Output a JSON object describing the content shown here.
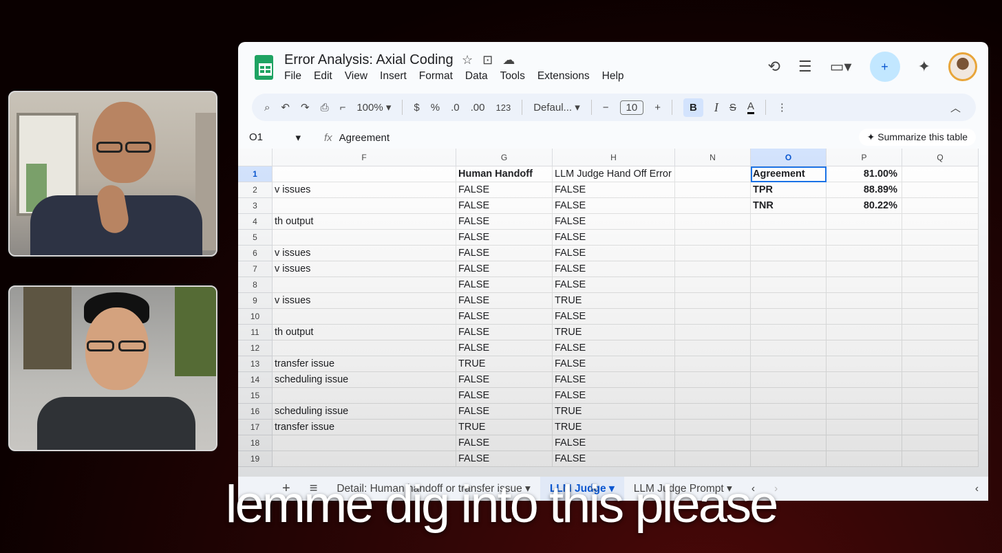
{
  "sheet": {
    "title": "Error Analysis: Axial Coding",
    "menu": [
      "File",
      "Edit",
      "View",
      "Insert",
      "Format",
      "Data",
      "Tools",
      "Extensions",
      "Help"
    ],
    "toolbar": {
      "zoom": "100%",
      "currency": "$",
      "percent": "%",
      "dec_decrease": ".0",
      "dec_increase": ".00",
      "more_formats": "123",
      "font": "Defaul...",
      "font_size": "10",
      "bold": "B",
      "italic": "I",
      "strike": "S",
      "text_color": "A"
    },
    "formula_bar": {
      "cell_ref": "O1",
      "fx": "fx",
      "content": "Agreement",
      "summarize": "Summarize this table"
    },
    "columns": [
      "F",
      "G",
      "H",
      "N",
      "O",
      "P",
      "Q"
    ],
    "selected_column": "O",
    "row_numbers": [
      "1",
      "2",
      "3",
      "4",
      "5",
      "6",
      "7",
      "8",
      "9",
      "10",
      "11",
      "12",
      "13",
      "14",
      "15",
      "16",
      "17",
      "18",
      "19"
    ],
    "rows": [
      {
        "f": "",
        "g": "Human Handoff",
        "h": "LLM Judge Hand Off Error",
        "o": "Agreement",
        "p": "81.00%"
      },
      {
        "f": "v issues",
        "g": "FALSE",
        "h": "FALSE",
        "o": "TPR",
        "p": "88.89%"
      },
      {
        "f": "",
        "g": "FALSE",
        "h": "FALSE",
        "o": "TNR",
        "p": "80.22%"
      },
      {
        "f": "th output",
        "g": "FALSE",
        "h": "FALSE",
        "o": "",
        "p": ""
      },
      {
        "f": "",
        "g": "FALSE",
        "h": "FALSE",
        "o": "",
        "p": ""
      },
      {
        "f": "v issues",
        "g": "FALSE",
        "h": "FALSE",
        "o": "",
        "p": ""
      },
      {
        "f": "v issues",
        "g": "FALSE",
        "h": "FALSE",
        "o": "",
        "p": ""
      },
      {
        "f": "",
        "g": "FALSE",
        "h": "FALSE",
        "o": "",
        "p": ""
      },
      {
        "f": "v issues",
        "g": "FALSE",
        "h": "TRUE",
        "o": "",
        "p": ""
      },
      {
        "f": "",
        "g": "FALSE",
        "h": "FALSE",
        "o": "",
        "p": ""
      },
      {
        "f": "th output",
        "g": "FALSE",
        "h": "TRUE",
        "o": "",
        "p": ""
      },
      {
        "f": "",
        "g": "FALSE",
        "h": "FALSE",
        "o": "",
        "p": ""
      },
      {
        "f": "transfer issue",
        "g": "TRUE",
        "h": "FALSE",
        "o": "",
        "p": ""
      },
      {
        "f": "scheduling issue",
        "g": "FALSE",
        "h": "FALSE",
        "o": "",
        "p": ""
      },
      {
        "f": "",
        "g": "FALSE",
        "h": "FALSE",
        "o": "",
        "p": ""
      },
      {
        "f": "scheduling issue",
        "g": "FALSE",
        "h": "TRUE",
        "o": "",
        "p": ""
      },
      {
        "f": "transfer issue",
        "g": "TRUE",
        "h": "TRUE",
        "o": "",
        "p": ""
      },
      {
        "f": "",
        "g": "FALSE",
        "h": "FALSE",
        "o": "",
        "p": ""
      },
      {
        "f": "",
        "g": "FALSE",
        "h": "FALSE",
        "o": "",
        "p": ""
      }
    ],
    "tabs": {
      "add": "+",
      "list": "≡",
      "tab1": "Detail: Human handoff or transfer issue",
      "tab2": "LLM Judge",
      "tab3": "LLM Judge Prompt"
    },
    "colors": {
      "accent": "#0b57d0",
      "selection": "#d3e3fd",
      "brand": "#1ea362"
    }
  },
  "caption": "lemme dig into this please"
}
